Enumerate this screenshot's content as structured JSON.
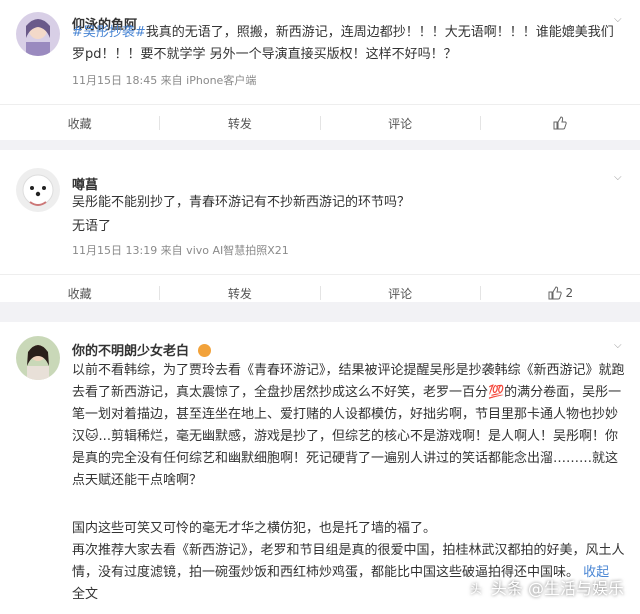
{
  "posts": [
    {
      "user": "仰泳的鱼阿",
      "topic": "#吴彤抄袭#",
      "text": "我真的无语了，照搬，新西游记，连周边都抄！！！大无语啊！！！谁能媲美我们罗pd！！！要不就学学 另外一个导演直接买版权！这样不好吗！？",
      "meta": "11月15日 18:45 来自 iPhone客户端",
      "actions": {
        "collect": "收藏",
        "forward": "转发",
        "comment": "评论",
        "like_count": ""
      }
    },
    {
      "user": "噂菖",
      "text1": "吴彤能不能别抄了，青春环游记有不抄新西游记的环节吗？",
      "text2": "无语了",
      "meta": "11月15日 13:19 来自 vivo AI智慧拍照X21",
      "actions": {
        "collect": "收藏",
        "forward": "转发",
        "comment": "评论",
        "like_count": "2"
      }
    },
    {
      "user": "你的不明朗少女老白",
      "para1": "以前不看韩综，为了贾玲去看《青春环游记》，结果被评论提醒吴彤是抄袭韩综《新西游记》就跑去看了新西游记，真太震惊了，全盘抄居然抄成这么不好笑，老罗一百分💯的满分卷面，吴彤一笔一划对着描边，甚至连坐在地上、爱打赌的人设都模仿，好拙劣啊，节目里那卡通人物也抄妙汉🐱...剪辑稀烂，毫无幽默感，游戏是抄了，但综艺的核心不是游戏啊！是人啊人！吴彤啊！你是真的完全没有任何综艺和幽默细胞啊！死记硬背了一遍别人讲过的笑话都能念出溜………就这点天赋还能干点啥啊？",
      "para2": "国内这些可笑又可怜的毫无才华之横仿犯，也是托了墙的福了。",
      "para3": "再次推荐大家去看《新西游记》，老罗和节目组是真的很爱中国，拍桂林武汉都拍的好美，风土人情，没有过度滤镜，拍一碗蛋炒饭和西红柿炒鸡蛋，都能比中国这些破逼拍得还中国味。",
      "collapse": "收起",
      "fulltext": "全文",
      "watermark": "头条 @生活与娱乐"
    }
  ],
  "colors": {
    "topic": "#4a86d4",
    "bg": "#f2f2f5",
    "card": "#ffffff"
  }
}
